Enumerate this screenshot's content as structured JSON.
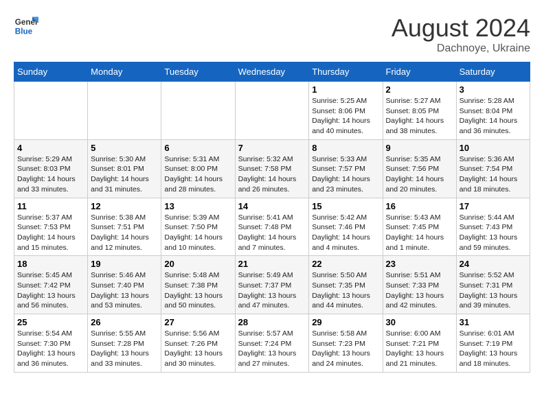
{
  "header": {
    "logo_general": "General",
    "logo_blue": "Blue",
    "month_year": "August 2024",
    "location": "Dachnoye, Ukraine"
  },
  "days_of_week": [
    "Sunday",
    "Monday",
    "Tuesday",
    "Wednesday",
    "Thursday",
    "Friday",
    "Saturday"
  ],
  "weeks": [
    [
      {
        "day": "",
        "info": ""
      },
      {
        "day": "",
        "info": ""
      },
      {
        "day": "",
        "info": ""
      },
      {
        "day": "",
        "info": ""
      },
      {
        "day": "1",
        "info": "Sunrise: 5:25 AM\nSunset: 8:06 PM\nDaylight: 14 hours and 40 minutes."
      },
      {
        "day": "2",
        "info": "Sunrise: 5:27 AM\nSunset: 8:05 PM\nDaylight: 14 hours and 38 minutes."
      },
      {
        "day": "3",
        "info": "Sunrise: 5:28 AM\nSunset: 8:04 PM\nDaylight: 14 hours and 36 minutes."
      }
    ],
    [
      {
        "day": "4",
        "info": "Sunrise: 5:29 AM\nSunset: 8:03 PM\nDaylight: 14 hours and 33 minutes."
      },
      {
        "day": "5",
        "info": "Sunrise: 5:30 AM\nSunset: 8:01 PM\nDaylight: 14 hours and 31 minutes."
      },
      {
        "day": "6",
        "info": "Sunrise: 5:31 AM\nSunset: 8:00 PM\nDaylight: 14 hours and 28 minutes."
      },
      {
        "day": "7",
        "info": "Sunrise: 5:32 AM\nSunset: 7:58 PM\nDaylight: 14 hours and 26 minutes."
      },
      {
        "day": "8",
        "info": "Sunrise: 5:33 AM\nSunset: 7:57 PM\nDaylight: 14 hours and 23 minutes."
      },
      {
        "day": "9",
        "info": "Sunrise: 5:35 AM\nSunset: 7:56 PM\nDaylight: 14 hours and 20 minutes."
      },
      {
        "day": "10",
        "info": "Sunrise: 5:36 AM\nSunset: 7:54 PM\nDaylight: 14 hours and 18 minutes."
      }
    ],
    [
      {
        "day": "11",
        "info": "Sunrise: 5:37 AM\nSunset: 7:53 PM\nDaylight: 14 hours and 15 minutes."
      },
      {
        "day": "12",
        "info": "Sunrise: 5:38 AM\nSunset: 7:51 PM\nDaylight: 14 hours and 12 minutes."
      },
      {
        "day": "13",
        "info": "Sunrise: 5:39 AM\nSunset: 7:50 PM\nDaylight: 14 hours and 10 minutes."
      },
      {
        "day": "14",
        "info": "Sunrise: 5:41 AM\nSunset: 7:48 PM\nDaylight: 14 hours and 7 minutes."
      },
      {
        "day": "15",
        "info": "Sunrise: 5:42 AM\nSunset: 7:46 PM\nDaylight: 14 hours and 4 minutes."
      },
      {
        "day": "16",
        "info": "Sunrise: 5:43 AM\nSunset: 7:45 PM\nDaylight: 14 hours and 1 minute."
      },
      {
        "day": "17",
        "info": "Sunrise: 5:44 AM\nSunset: 7:43 PM\nDaylight: 13 hours and 59 minutes."
      }
    ],
    [
      {
        "day": "18",
        "info": "Sunrise: 5:45 AM\nSunset: 7:42 PM\nDaylight: 13 hours and 56 minutes."
      },
      {
        "day": "19",
        "info": "Sunrise: 5:46 AM\nSunset: 7:40 PM\nDaylight: 13 hours and 53 minutes."
      },
      {
        "day": "20",
        "info": "Sunrise: 5:48 AM\nSunset: 7:38 PM\nDaylight: 13 hours and 50 minutes."
      },
      {
        "day": "21",
        "info": "Sunrise: 5:49 AM\nSunset: 7:37 PM\nDaylight: 13 hours and 47 minutes."
      },
      {
        "day": "22",
        "info": "Sunrise: 5:50 AM\nSunset: 7:35 PM\nDaylight: 13 hours and 44 minutes."
      },
      {
        "day": "23",
        "info": "Sunrise: 5:51 AM\nSunset: 7:33 PM\nDaylight: 13 hours and 42 minutes."
      },
      {
        "day": "24",
        "info": "Sunrise: 5:52 AM\nSunset: 7:31 PM\nDaylight: 13 hours and 39 minutes."
      }
    ],
    [
      {
        "day": "25",
        "info": "Sunrise: 5:54 AM\nSunset: 7:30 PM\nDaylight: 13 hours and 36 minutes."
      },
      {
        "day": "26",
        "info": "Sunrise: 5:55 AM\nSunset: 7:28 PM\nDaylight: 13 hours and 33 minutes."
      },
      {
        "day": "27",
        "info": "Sunrise: 5:56 AM\nSunset: 7:26 PM\nDaylight: 13 hours and 30 minutes."
      },
      {
        "day": "28",
        "info": "Sunrise: 5:57 AM\nSunset: 7:24 PM\nDaylight: 13 hours and 27 minutes."
      },
      {
        "day": "29",
        "info": "Sunrise: 5:58 AM\nSunset: 7:23 PM\nDaylight: 13 hours and 24 minutes."
      },
      {
        "day": "30",
        "info": "Sunrise: 6:00 AM\nSunset: 7:21 PM\nDaylight: 13 hours and 21 minutes."
      },
      {
        "day": "31",
        "info": "Sunrise: 6:01 AM\nSunset: 7:19 PM\nDaylight: 13 hours and 18 minutes."
      }
    ]
  ]
}
